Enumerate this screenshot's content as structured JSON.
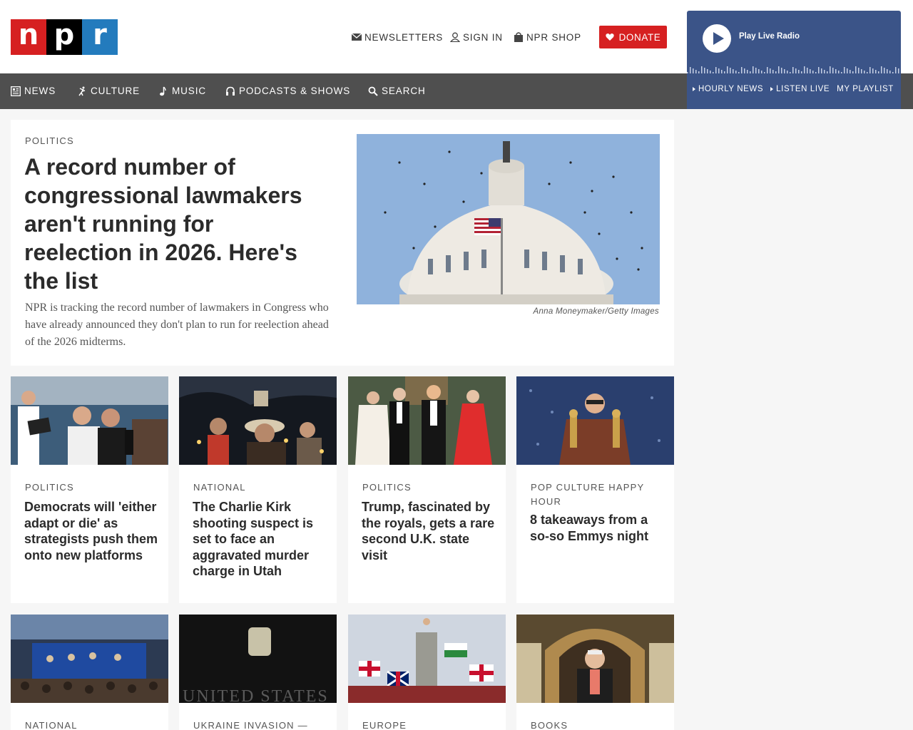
{
  "logo": {
    "letters": [
      "n",
      "p",
      "r"
    ]
  },
  "header": {
    "newsletters": "Newsletters",
    "sign_in": "Sign In",
    "shop": "NPR Shop",
    "donate": "Donate"
  },
  "player": {
    "play_label": "Play Live Radio",
    "links": [
      "Hourly News",
      "Listen Live",
      "My Playlist"
    ]
  },
  "nav": {
    "items": [
      "News",
      "Culture",
      "Music",
      "Podcasts & Shows",
      "Search"
    ]
  },
  "hero": {
    "kicker": "Politics",
    "title": "A record number of congressional lawmakers aren't running for reelection in 2026. Here's the list",
    "teaser": "NPR is tracking the record number of lawmakers in Congress who have already announced they don't plan to run for reelection ahead of the 2026 midterms.",
    "credit": "Anna Moneymaker/Getty Images"
  },
  "cards": [
    {
      "kicker": "Politics",
      "title": "Democrats will 'either adapt or die' as strategists push them onto new platforms"
    },
    {
      "kicker": "National",
      "title": "The Charlie Kirk shooting suspect is set to face an aggravated murder charge in Utah"
    },
    {
      "kicker": "Politics",
      "title": "Trump, fascinated by the royals, gets a rare second U.K. state visit"
    },
    {
      "kicker": "Pop Culture Happy Hour",
      "title": "8 takeaways from a so-so Emmys night"
    },
    {
      "kicker": "National",
      "title": ""
    },
    {
      "kicker": "Ukraine invasion —",
      "title": ""
    },
    {
      "kicker": "Europe",
      "title": ""
    },
    {
      "kicker": "Books",
      "title": ""
    }
  ],
  "colors": {
    "brand_red": "#d62021",
    "brand_blue": "#237bbd",
    "nav_gray": "#4f4f4f",
    "player_blue": "#3b5488"
  }
}
